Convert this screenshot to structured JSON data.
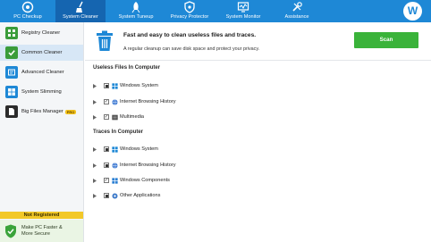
{
  "nav": {
    "tabs": [
      {
        "label": "PC Checkup",
        "icon": "checkup-icon"
      },
      {
        "label": "System Cleaner",
        "icon": "broom-icon",
        "active": true
      },
      {
        "label": "System Tuneup",
        "icon": "rocket-icon"
      },
      {
        "label": "Privacy Protector",
        "icon": "shield-icon"
      },
      {
        "label": "System Monitor",
        "icon": "monitor-icon"
      },
      {
        "label": "Assistance",
        "icon": "tools-icon"
      }
    ],
    "avatar_letter": "W"
  },
  "sidebar": {
    "items": [
      {
        "label": "Registry Cleaner",
        "icon": "registry-icon"
      },
      {
        "label": "Common Cleaner",
        "icon": "check-icon",
        "active": true
      },
      {
        "label": "Advanced Cleaner",
        "icon": "advanced-cleaner-icon"
      },
      {
        "label": "System Slimming",
        "icon": "windows-icon"
      },
      {
        "label": "Big Files Manager",
        "icon": "big-files-icon",
        "badge": "PRO"
      }
    ],
    "not_registered": "Not Registered",
    "promo_line1": "Make PC Faster &",
    "promo_line2": "More Secure"
  },
  "header": {
    "title": "Fast and easy to clean useless files and traces.",
    "subtitle": "A regular cleanup can save disk space and protect your privacy.",
    "scan_label": "Scan"
  },
  "sections": [
    {
      "title": "Useless Files In Computer",
      "items": [
        {
          "label": "Windows System",
          "state": "partial",
          "icon": "windows-icon"
        },
        {
          "label": "Internet Browsing History",
          "state": "checked",
          "icon": "globe-icon"
        },
        {
          "label": "Multimedia",
          "state": "checked",
          "icon": "multimedia-icon"
        }
      ]
    },
    {
      "title": "Traces In Computer",
      "items": [
        {
          "label": "Windows System",
          "state": "partial",
          "icon": "windows-icon"
        },
        {
          "label": "Internet Browsing History",
          "state": "partial",
          "icon": "globe-icon"
        },
        {
          "label": "Windows Components",
          "state": "checked",
          "icon": "components-icon"
        },
        {
          "label": "Other Applications",
          "state": "partial",
          "icon": "apps-icon"
        }
      ]
    }
  ],
  "colors": {
    "nav_bg": "#1e88d6",
    "nav_active": "#1565b0",
    "scan_green": "#3ab33a",
    "sidebar_active": "#d7e7f6",
    "not_registered_bg": "#f2c829"
  }
}
